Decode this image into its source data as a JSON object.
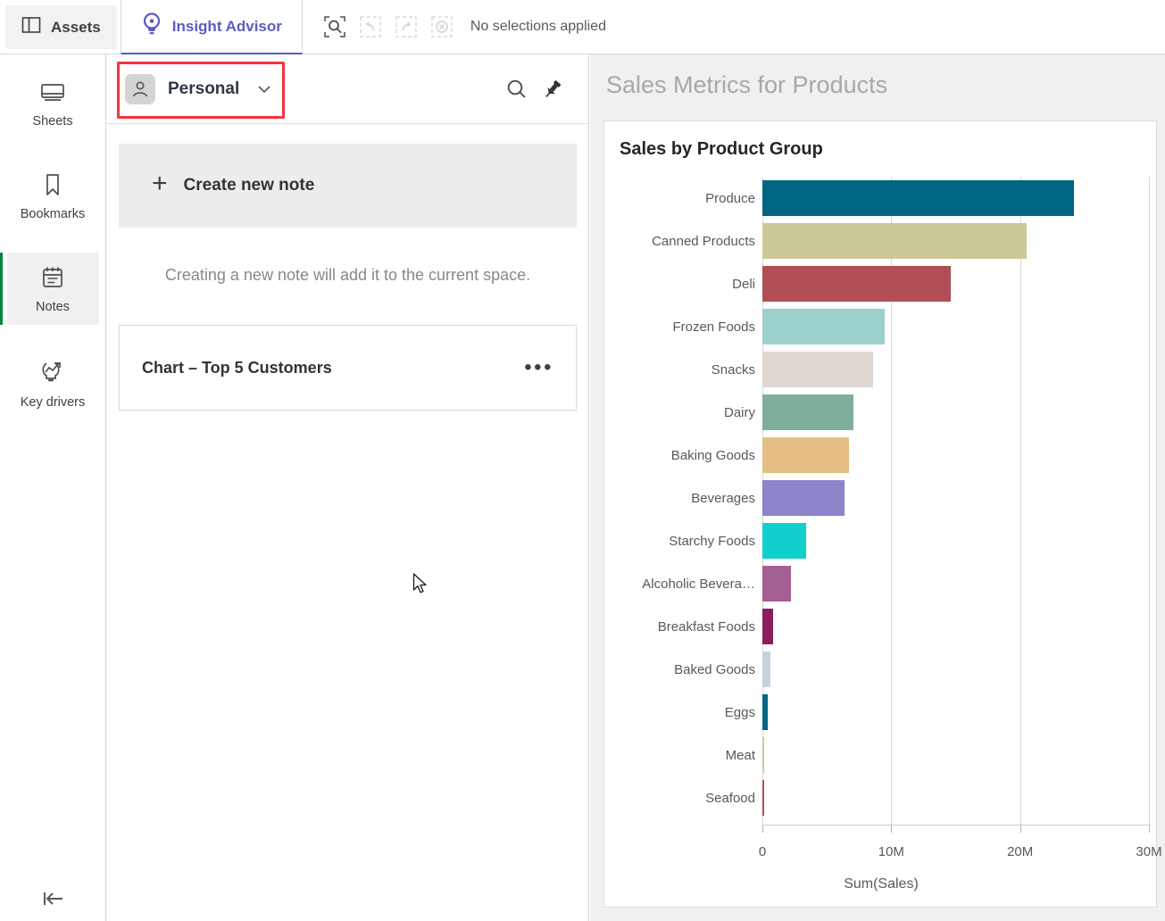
{
  "topbar": {
    "tabs": [
      {
        "label": "Assets",
        "icon": "panel-icon",
        "active": false
      },
      {
        "label": "Insight Advisor",
        "icon": "lightbulb-eye-icon",
        "active": true
      }
    ],
    "selection_tools": [
      {
        "name": "selection-search-button",
        "enabled": true
      },
      {
        "name": "undo-button",
        "enabled": false
      },
      {
        "name": "redo-button",
        "enabled": false
      },
      {
        "name": "clear-selections-button",
        "enabled": false
      }
    ],
    "selection_status": "No selections applied",
    "accent_color": "#5b5bc2"
  },
  "rail": {
    "items": [
      {
        "label": "Sheets",
        "icon": "sheets-icon",
        "active": false
      },
      {
        "label": "Bookmarks",
        "icon": "bookmark-icon",
        "active": false
      },
      {
        "label": "Notes",
        "icon": "notes-icon",
        "active": true
      },
      {
        "label": "Key drivers",
        "icon": "key-drivers-icon",
        "active": false
      }
    ],
    "collapse_icon": "collapse-left-icon",
    "active_indicator_color": "#00873d"
  },
  "notes": {
    "space_name": "Personal",
    "space_avatar_icon": "person-icon",
    "dropdown_icon": "chevron-down-icon",
    "search_icon": "search-icon",
    "pin_icon": "pin-icon",
    "create_label": "Create new note",
    "create_icon": "plus-icon",
    "hint": "Creating a new note will add it to the current space.",
    "highlight_color": "#f5333f",
    "note_items": [
      {
        "title": "Chart – Top 5 Customers",
        "menu_icon": "more-options-icon"
      }
    ]
  },
  "right_pane": {
    "title": "Sales Metrics for Products"
  },
  "chart_data": {
    "type": "bar",
    "orientation": "horizontal",
    "title": "Sales by Product Group",
    "xlabel": "Sum(Sales)",
    "ylabel": "",
    "xlim": [
      0,
      30000000
    ],
    "xticks": [
      0,
      10000000,
      20000000,
      30000000
    ],
    "xtick_labels": [
      "0",
      "10M",
      "20M",
      "30M"
    ],
    "grid": true,
    "legend": "none",
    "categories": [
      "Produce",
      "Canned Products",
      "Deli",
      "Frozen Foods",
      "Snacks",
      "Dairy",
      "Baking Goods",
      "Beverages",
      "Starchy Foods",
      "Alcoholic Bevera…",
      "Breakfast Foods",
      "Baked Goods",
      "Eggs",
      "Meat",
      "Seafood"
    ],
    "values": [
      24200000,
      20500000,
      14600000,
      9500000,
      8600000,
      7100000,
      6700000,
      6400000,
      3400000,
      2200000,
      800000,
      600000,
      450000,
      60000,
      50000
    ],
    "colors": [
      "#006580",
      "#cbc999",
      "#b14e56",
      "#9bd0cd",
      "#e0d8d3",
      "#7faf9a",
      "#e6bf86",
      "#8b85cc",
      "#11cfcc",
      "#a45f93",
      "#8a1f5b",
      "#c8d2dc",
      "#006580",
      "#cbc999",
      "#b14e56"
    ]
  }
}
